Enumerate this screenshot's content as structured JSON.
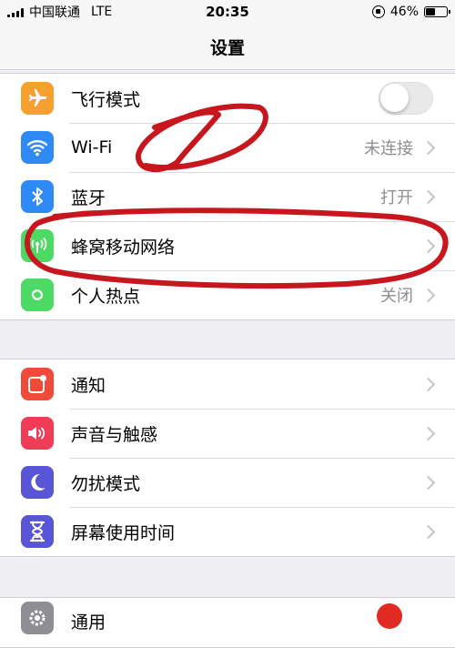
{
  "status_bar": {
    "carrier": "中国联通",
    "network": "LTE",
    "time": "20:35",
    "battery_text": "46%",
    "battery_level": 0.46
  },
  "nav": {
    "title": "设置"
  },
  "group1": [
    {
      "label": "飞行模式",
      "icon": "airplane-icon",
      "color": "#f7a02f",
      "toggle_on": false
    },
    {
      "label": "Wi-Fi",
      "icon": "wifi-icon",
      "color": "#2f8af6",
      "value": "未连接"
    },
    {
      "label": "蓝牙",
      "icon": "bluetooth-icon",
      "color": "#2f8af6",
      "value": "打开"
    },
    {
      "label": "蜂窝移动网络",
      "icon": "cellular-icon",
      "color": "#4cd964"
    },
    {
      "label": "个人热点",
      "icon": "hotspot-icon",
      "color": "#4cd964",
      "value": "关闭"
    }
  ],
  "group2": [
    {
      "label": "通知",
      "icon": "notification-icon",
      "color": "#f04a3b"
    },
    {
      "label": "声音与触感",
      "icon": "sound-icon",
      "color": "#f03c56"
    },
    {
      "label": "勿扰模式",
      "icon": "moon-icon",
      "color": "#5856d6"
    },
    {
      "label": "屏幕使用时间",
      "icon": "hourglass-icon",
      "color": "#5856d6"
    }
  ],
  "group3": [
    {
      "label": "通用",
      "icon": "gear-icon",
      "color": "#8e8e93"
    }
  ],
  "colors": {
    "background": "#efeff4",
    "chevron": "#c4c4c9",
    "annotation": "#c8161e"
  }
}
